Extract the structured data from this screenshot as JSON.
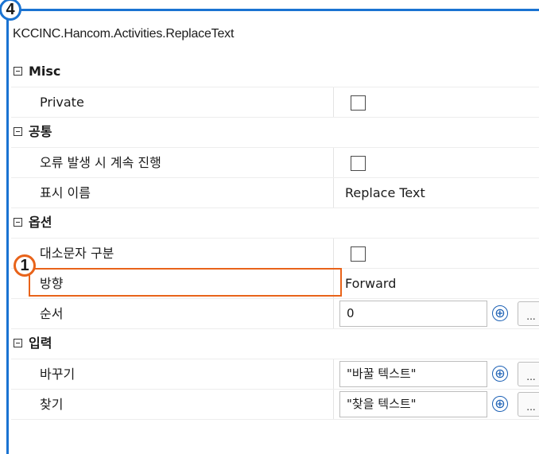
{
  "window": {
    "title": "KCCINC.Hancom.Activities.ReplaceText"
  },
  "annotations": {
    "badge_frame": "4",
    "badge_highlight": "1"
  },
  "colors": {
    "frame_accent": "#1a73d2",
    "highlight_accent": "#e8631a"
  },
  "categories": {
    "misc": {
      "label": "Misc",
      "private": {
        "name": "Private",
        "checked": false
      }
    },
    "common": {
      "label": "공통",
      "continue_on_error": {
        "name": "오류 발생 시 계속 진행",
        "checked": false
      },
      "display_name": {
        "name": "표시 이름",
        "value": "Replace Text"
      }
    },
    "options": {
      "label": "옵션",
      "case_sensitive": {
        "name": "대소문자 구분",
        "checked": false
      },
      "direction": {
        "name": "방향",
        "value": "Forward"
      },
      "order": {
        "name": "순서",
        "value": "0"
      }
    },
    "input": {
      "label": "입력",
      "replace": {
        "name": "바꾸기",
        "value": "\"바꿀 텍스트\""
      },
      "find": {
        "name": "찾기",
        "value": "\"찾을 텍스트\""
      }
    }
  },
  "buttons": {
    "plus": "⊕",
    "more": "..."
  }
}
